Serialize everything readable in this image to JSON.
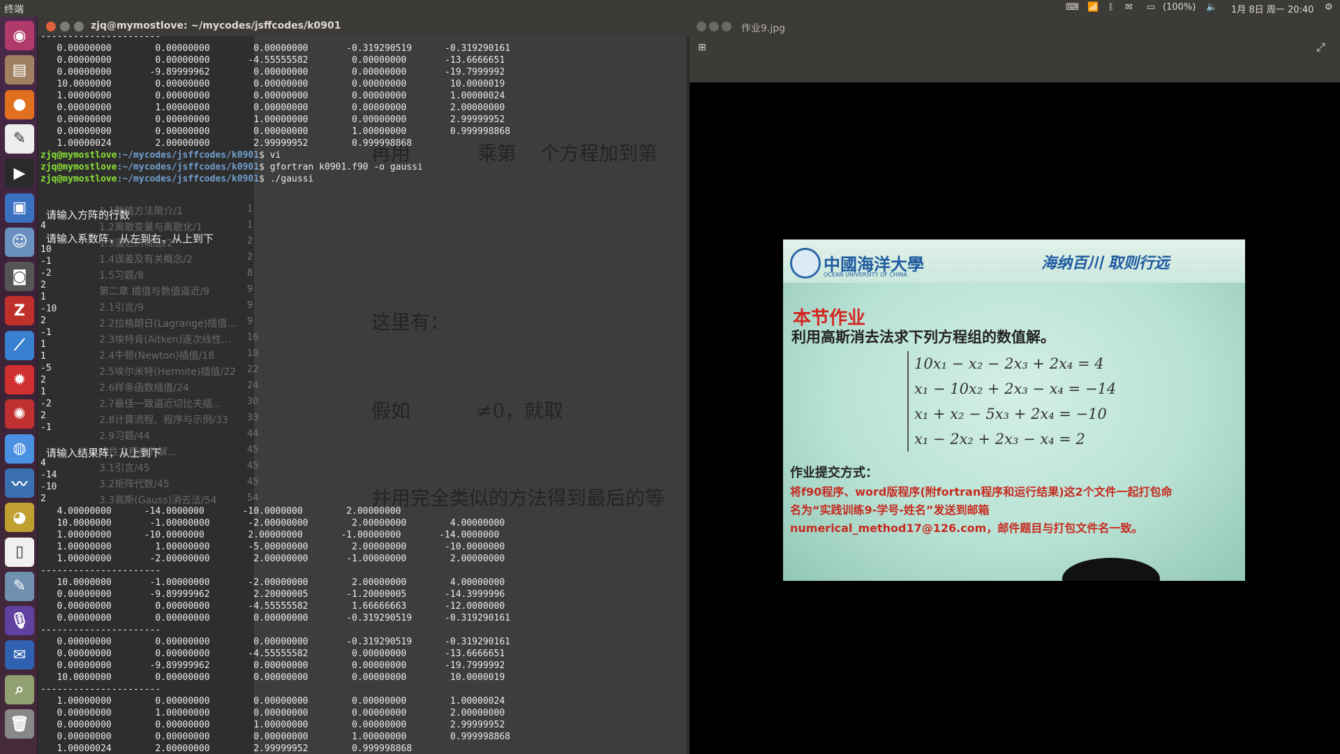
{
  "topbar": {
    "app_name": "终端",
    "battery": "(100%)",
    "datetime": "1月 8日 周一 20:40"
  },
  "launcher": {
    "items": [
      "ubuntu-dash-icon",
      "files-icon",
      "firefox-icon",
      "text-editor-icon",
      "terminal-icon",
      "document-viewer-icon",
      "contacts-icon",
      "camera-icon",
      "app-z-icon",
      "system-monitor-icon",
      "settings-gear-icon",
      "cog-red-icon",
      "chrome-icon",
      "waveform-icon",
      "globe-icon",
      "blank-document-icon",
      "image-editor-icon",
      "microphone-icon",
      "thunderbird-icon",
      "screenshot-icon",
      "trash-icon"
    ]
  },
  "terminal": {
    "title": "zjq@mymostlove: ~/mycodes/jsffcodes/k0901",
    "user_host": "zjq@mymostlove",
    "path": ":~/mycodes/jsffcodes/k0901",
    "lines": [
      {
        "t": "----------------------"
      },
      {
        "t": "   0.00000000        0.00000000        0.00000000       -0.319290519      -0.319290161"
      },
      {
        "t": "   0.00000000        0.00000000       -4.55555582        0.00000000       -13.6666651"
      },
      {
        "t": "   0.00000000       -9.89999962        0.00000000        0.00000000       -19.7999992"
      },
      {
        "t": "   10.0000000        0.00000000        0.00000000        0.00000000        10.0000019"
      },
      {
        "t": "   1.00000000        0.00000000        0.00000000        0.00000000        1.00000024"
      },
      {
        "t": "   0.00000000        1.00000000        0.00000000        0.00000000        2.00000000"
      },
      {
        "t": "   0.00000000        0.00000000        1.00000000        0.00000000        2.99999952"
      },
      {
        "t": "   0.00000000        0.00000000        0.00000000        1.00000000        0.999998868"
      },
      {
        "t": "   1.00000024        2.00000000        2.99999952        0.999998868"
      },
      {
        "prompt": true,
        "cmd": "$ vi"
      },
      {
        "prompt": true,
        "cmd": "$ gfortran k0901.f90 -o gaussi"
      },
      {
        "prompt": true,
        "cmd": "$ ./gaussi"
      }
    ],
    "cjk1": "请输入方阵的行数",
    "cjk1_val": "4",
    "cjk2": "请输入系数阵，从左到右，从上到下",
    "coef": [
      "10",
      "-1",
      "-2",
      "2",
      "1",
      "-10",
      "2",
      "-1",
      "1",
      "1",
      "-5",
      "2",
      "1",
      "-2",
      "2",
      "-1"
    ],
    "cjk3": "请输入结果阵，从上到下",
    "rhs": [
      "4",
      "-14",
      "-10",
      "2"
    ],
    "lines2": [
      {
        "t": "   4.00000000      -14.0000000       -10.0000000        2.00000000"
      },
      {
        "t": "   10.0000000       -1.00000000       -2.00000000        2.00000000        4.00000000"
      },
      {
        "t": "   1.00000000      -10.0000000        2.00000000       -1.00000000       -14.0000000"
      },
      {
        "t": "   1.00000000        1.00000000       -5.00000000        2.00000000       -10.0000000"
      },
      {
        "t": "   1.00000000       -2.00000000        2.00000000       -1.00000000        2.00000000"
      },
      {
        "t": "----------------------"
      },
      {
        "t": "   10.0000000       -1.00000000       -2.00000000        2.00000000        4.00000000"
      },
      {
        "t": "   0.00000000       -9.89999962        2.20000005       -1.20000005       -14.3999996"
      },
      {
        "t": "   0.00000000        0.00000000       -4.55555582        1.66666663       -12.0000000"
      },
      {
        "t": "   0.00000000        0.00000000        0.00000000       -0.319290519      -0.319290161"
      },
      {
        "t": "----------------------"
      },
      {
        "t": "   0.00000000        0.00000000        0.00000000       -0.319290519      -0.319290161"
      },
      {
        "t": "   0.00000000        0.00000000       -4.55555582        0.00000000       -13.6666651"
      },
      {
        "t": "   0.00000000       -9.89999962        0.00000000        0.00000000       -19.7999992"
      },
      {
        "t": "   10.0000000        0.00000000        0.00000000        0.00000000        10.0000019"
      },
      {
        "t": "----------------------"
      },
      {
        "t": "   1.00000000        0.00000000        0.00000000        0.00000000        1.00000024"
      },
      {
        "t": "   0.00000000        1.00000000        0.00000000        0.00000000        2.00000000"
      },
      {
        "t": "   0.00000000        0.00000000        1.00000000        0.00000000        2.99999952"
      },
      {
        "t": "   0.00000000        0.00000000        0.00000000        1.00000000        0.999998868"
      },
      {
        "t": "   1.00000024        2.00000000        2.99999952        0.999998868"
      }
    ],
    "final_prompt": "$ _"
  },
  "ghost_doc": {
    "toc": [
      {
        "t": "1.1数值方法简介/1",
        "n": "1"
      },
      {
        "t": "1.2离散变量与离散化/1",
        "n": "1"
      },
      {
        "t": "1.3逼近的概念/2",
        "n": "2"
      },
      {
        "t": "1.4误差及有关概念/2",
        "n": "2"
      },
      {
        "t": "1.5习题/8",
        "n": "8"
      },
      {
        "t": "第二章 插值与数值逼近/9",
        "n": "9"
      },
      {
        "t": "2.1引言/9",
        "n": "9"
      },
      {
        "t": "2.2拉格朗日(Lagrange)插值…",
        "n": "9"
      },
      {
        "t": "2.3埃特肯(Aitken)逐次线性…",
        "n": "16"
      },
      {
        "t": "2.4牛顿(Newton)插值/18",
        "n": "18"
      },
      {
        "t": "2.5埃尔米特(Hermite)插值/22",
        "n": "22"
      },
      {
        "t": "2.6样条函数插值/24",
        "n": "24"
      },
      {
        "t": "2.7最佳一致逼近切比夫插…",
        "n": "30"
      },
      {
        "t": "2.8计算流程、程序与示例/33",
        "n": "33"
      },
      {
        "t": "2.9习题/44",
        "n": "44"
      },
      {
        "t": "线性方程组的解…",
        "n": "45"
      },
      {
        "t": "3.1引言/45",
        "n": "45"
      },
      {
        "t": "3.2矩阵代数/45",
        "n": "45"
      },
      {
        "t": "3.3高斯(Gauss)消去法/54",
        "n": "54"
      }
    ],
    "math_text": [
      "这里有：",
      "假如",
      "≠0，就取",
      "并用完全类似的方法得到最后的等",
      "再用",
      "乘第",
      "个方程加到第"
    ]
  },
  "viewer": {
    "title": "作业9.jpg",
    "photo": {
      "university": "中國海洋大學",
      "university_en": "OCEAN UNIVERSITY OF CHINA",
      "motto": "海纳百川 取则行远",
      "heading": "本节作业",
      "task": "利用高斯消去法求下列方程组的数值解。",
      "equations": [
        "10x₁ − x₂ − 2x₃ + 2x₄ = 4",
        "x₁ − 10x₂ + 2x₃ − x₄ = −14",
        "x₁ + x₂ − 5x₃ + 2x₄ = −10",
        "x₁ − 2x₂ + 2x₃ − x₄ = 2"
      ],
      "submit_label": "作业提交方式：",
      "submit_line1": "将f90程序、word版程序(附fortran程序和运行结果)这2个文件一起打包命",
      "submit_line2": "名为“实践训练9-学号-姓名”发送到邮箱",
      "submit_line3": "numerical_method17@126.com，邮件题目与打包文件名一致。"
    }
  }
}
